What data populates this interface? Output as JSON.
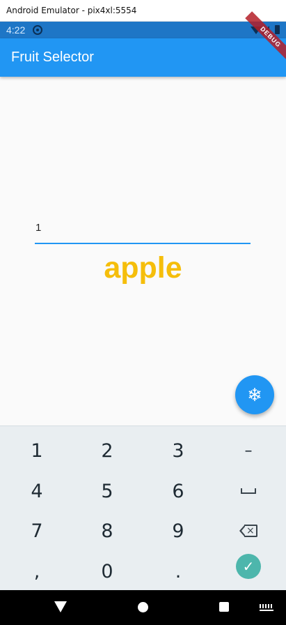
{
  "window": {
    "title": "Android Emulator - pix4xl:5554"
  },
  "status_bar": {
    "time": "4:22",
    "icons": [
      "sync-icon",
      "wifi-icon",
      "signal-icon",
      "battery-icon"
    ],
    "color": "#1e76c6"
  },
  "debug_banner": {
    "label": "DEBUG"
  },
  "app_bar": {
    "title": "Fruit Selector",
    "color": "#2196f3"
  },
  "input": {
    "value": "1"
  },
  "result": {
    "fruit": "apple",
    "color": "#f5be0b"
  },
  "fab": {
    "icon": "snowflake-icon",
    "glyph": "❄"
  },
  "keyboard": {
    "rows": [
      [
        "1",
        "2",
        "3",
        "–"
      ],
      [
        "4",
        "5",
        "6",
        "space"
      ],
      [
        "7",
        "8",
        "9",
        "backspace"
      ],
      [
        ",",
        "0",
        ".",
        "enter"
      ]
    ],
    "labels": {
      "k1": "1",
      "k2": "2",
      "k3": "3",
      "minus": "–",
      "k4": "4",
      "k5": "5",
      "k6": "6",
      "k7": "7",
      "k8": "8",
      "k9": "9",
      "comma": ",",
      "k0": "0",
      "period": "."
    },
    "enter_glyph": "✓",
    "enter_color": "#4db6ac"
  },
  "nav_bar": {
    "icons": [
      "back-icon",
      "home-icon",
      "recents-icon",
      "keyboard-icon"
    ]
  }
}
